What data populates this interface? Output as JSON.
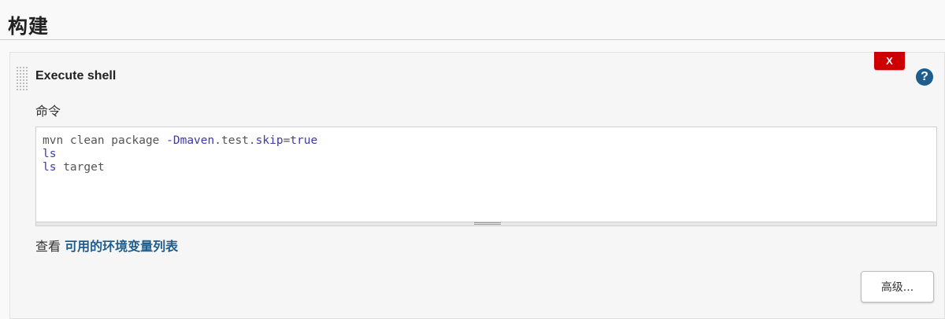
{
  "section": {
    "title": "构建"
  },
  "step": {
    "title": "Execute shell",
    "delete_label": "X",
    "help_label": "?",
    "help_icon": "question-circle-icon",
    "command_label": "命令",
    "command_lines": [
      [
        {
          "t": "mvn clean package ",
          "c": "plain"
        },
        {
          "t": "-Dmaven",
          "c": "opt"
        },
        {
          "t": ".test.",
          "c": "plain"
        },
        {
          "t": "skip",
          "c": "kw"
        },
        {
          "t": "=",
          "c": "plain"
        },
        {
          "t": "true",
          "c": "kw"
        }
      ],
      [
        {
          "t": "ls",
          "c": "kw"
        }
      ],
      [
        {
          "t": "ls",
          "c": "kw"
        },
        {
          "t": " target",
          "c": "plain"
        }
      ]
    ],
    "env_prefix": "查看",
    "env_link": "可用的环境变量列表",
    "advanced_label": "高级..."
  },
  "colors": {
    "delete_button": "#cc0000",
    "help_icon": "#1e5d8d",
    "link": "#1e5d8d",
    "syntax_keyword": "#3a3aa8"
  }
}
